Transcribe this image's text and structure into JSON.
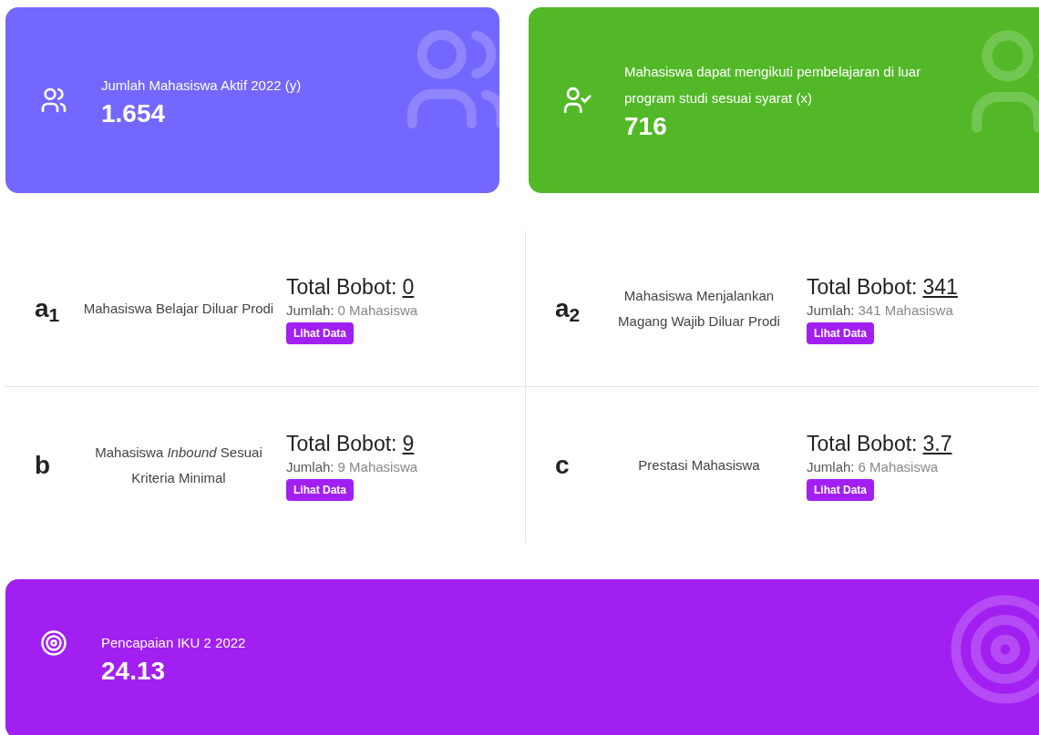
{
  "top_cards": [
    {
      "kind": "users",
      "color": "#7367ff",
      "title": "Jumlah Mahasiswa Aktif 2022 (y)",
      "value": "1.654"
    },
    {
      "kind": "user-check",
      "color": "#52b827",
      "title": "Mahasiswa dapat mengikuti pembelajaran di luar program studi sesuai syarat (x)",
      "value": "716"
    }
  ],
  "criteria": [
    {
      "label": "a$_{1}$",
      "description": "Mahasiswa Belajar Diluar Prodi",
      "total_label": "Total Bobot:",
      "total": "0",
      "count_label": "Jumlah:",
      "count": "0 Mahasiswa",
      "button": "Lihat Data"
    },
    {
      "label": "a$_{2}$",
      "description": "Mahasiswa Menjalankan Magang Wajib Diluar Prodi",
      "total_label": "Total Bobot:",
      "total": "341",
      "count_label": "Jumlah:",
      "count": "341 Mahasiswa",
      "button": "Lihat Data"
    },
    {
      "label": "b",
      "description": "Mahasiswa *Inbound* Sesuai Kriteria Minimal",
      "total_label": "Total Bobot:",
      "total": "9",
      "count_label": "Jumlah:",
      "count": "9 Mahasiswa",
      "button": "Lihat Data"
    },
    {
      "label": "c",
      "description": "Prestasi Mahasiswa",
      "total_label": "Total Bobot:",
      "total": "3.7",
      "count_label": "Jumlah:",
      "count": "6 Mahasiswa",
      "button": "Lihat Data"
    }
  ],
  "achievement": {
    "kind": "target",
    "color": "#a21ff2",
    "title": "Pencapaian IKU 2 2022",
    "value": "24.13"
  }
}
